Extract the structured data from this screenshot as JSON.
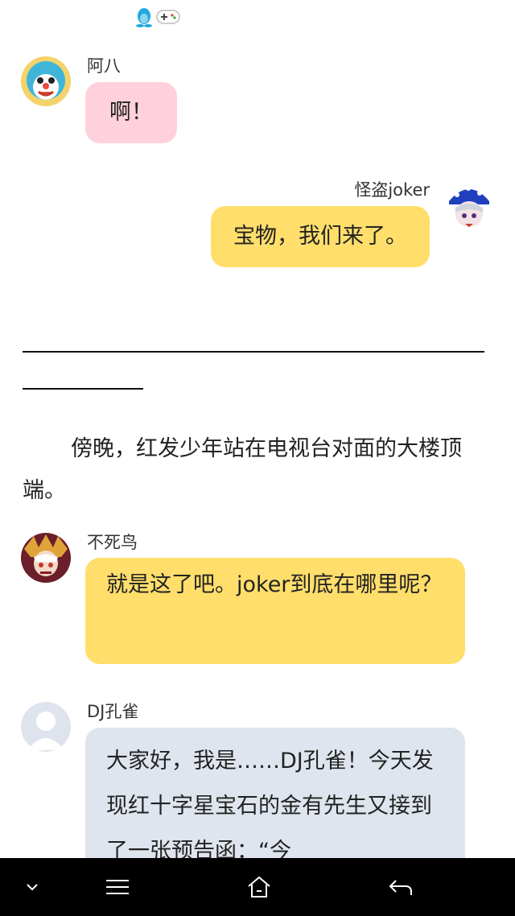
{
  "messages": [
    {
      "sender": "阿八",
      "text": "啊！"
    },
    {
      "sender": "怪盗joker",
      "text": "宝物，我们来了。"
    },
    {
      "sender": "不死鸟",
      "text": "就是这了吧。joker到底在哪里呢？"
    },
    {
      "sender": "DJ孔雀",
      "text": "大家好，我是……DJ孔雀！今天发现红十字星宝石的金有先生又接到了一张预告函：“今"
    }
  ],
  "narration": "傍晚，红发少年站在电视台对面的大楼顶端。",
  "colors": {
    "pink_bubble": "#ffd1dc",
    "yellow_bubble": "#ffde6b",
    "blue_bubble": "#dfe5ee",
    "navbar": "#000000"
  },
  "status_icons": [
    "qq-penguin-icon",
    "gamepad-icon"
  ],
  "navbar_icons": [
    "chevron-down-icon",
    "menu-icon",
    "home-icon",
    "back-icon"
  ]
}
